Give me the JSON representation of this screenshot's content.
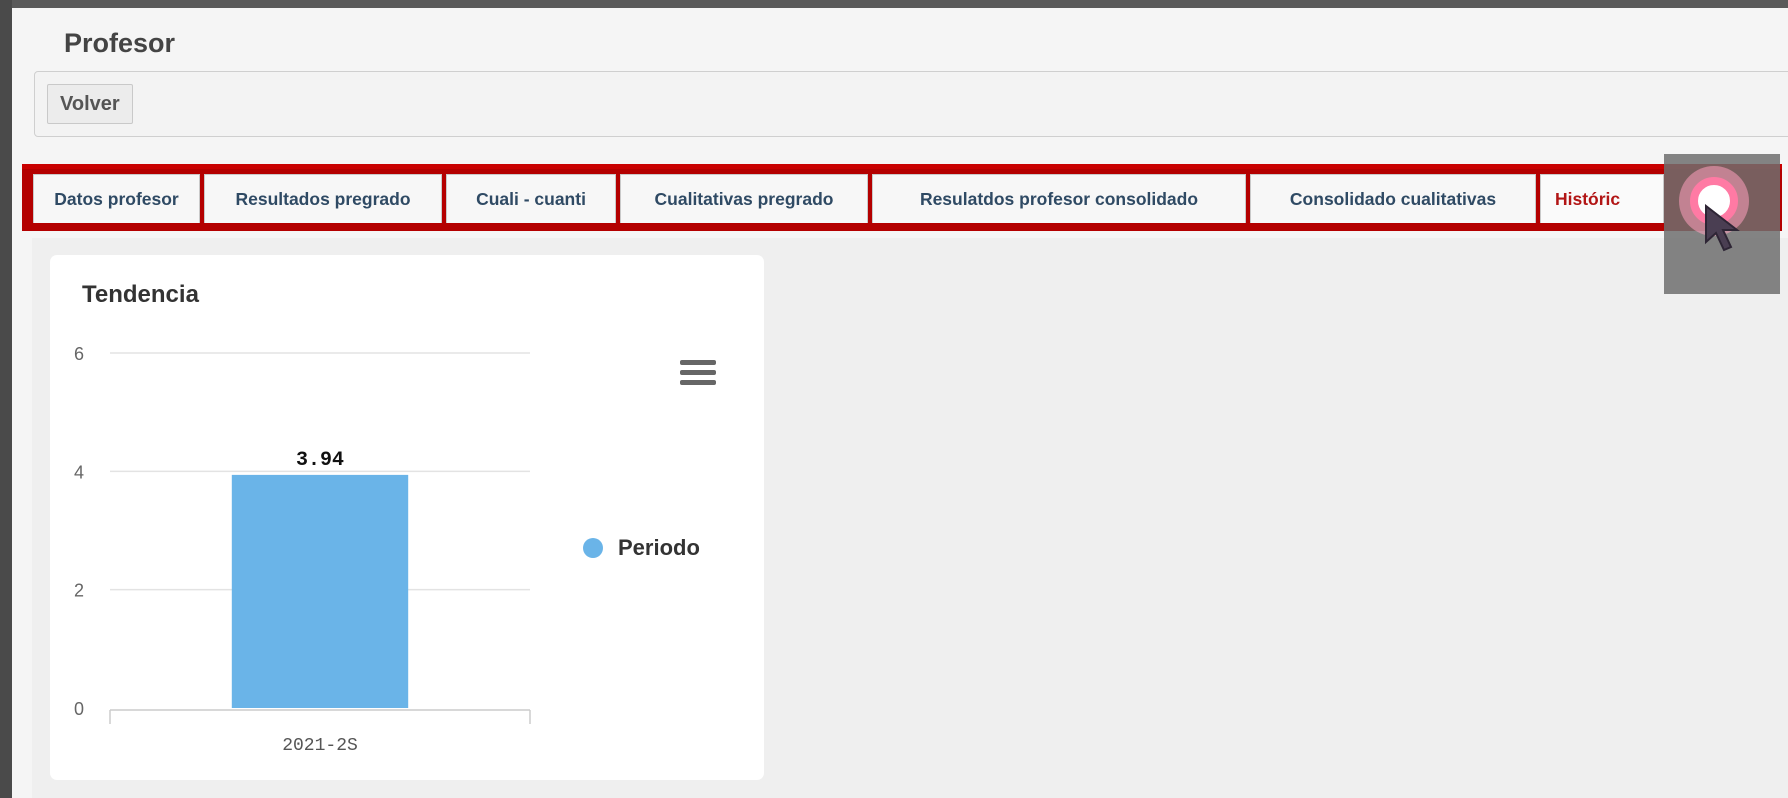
{
  "page": {
    "title": "Profesor"
  },
  "toolbar": {
    "back_label": "Volver"
  },
  "tabs": [
    {
      "label": "Datos profesor"
    },
    {
      "label": "Resultados pregrado"
    },
    {
      "label": "Cuali - cuanti"
    },
    {
      "label": "Cualitativas pregrado"
    },
    {
      "label": "Resulatdos profesor consolidado"
    },
    {
      "label": "Consolidado cualitativas"
    },
    {
      "label": "Históric"
    }
  ],
  "card": {
    "title": "Tendencia",
    "menu_icon": "hamburger-menu-icon"
  },
  "chart_data": {
    "type": "bar",
    "title": "Tendencia",
    "categories": [
      "2021-2S"
    ],
    "series": [
      {
        "name": "Periodo",
        "values": [
          3.94
        ],
        "color": "#6ab4e8"
      }
    ],
    "data_labels": [
      "3.94"
    ],
    "yticks": [
      "0",
      "2",
      "4",
      "6"
    ],
    "ylim": [
      0,
      6
    ],
    "grid": true,
    "legend": "right"
  },
  "colors": {
    "tab_bar": "#b40000",
    "active_tab_text": "#b21515",
    "tab_text": "#2f4a64",
    "bar": "#6ab4e8"
  },
  "icons": {
    "cursor": "mouse-pointer-icon",
    "click": "click-indicator-icon"
  }
}
